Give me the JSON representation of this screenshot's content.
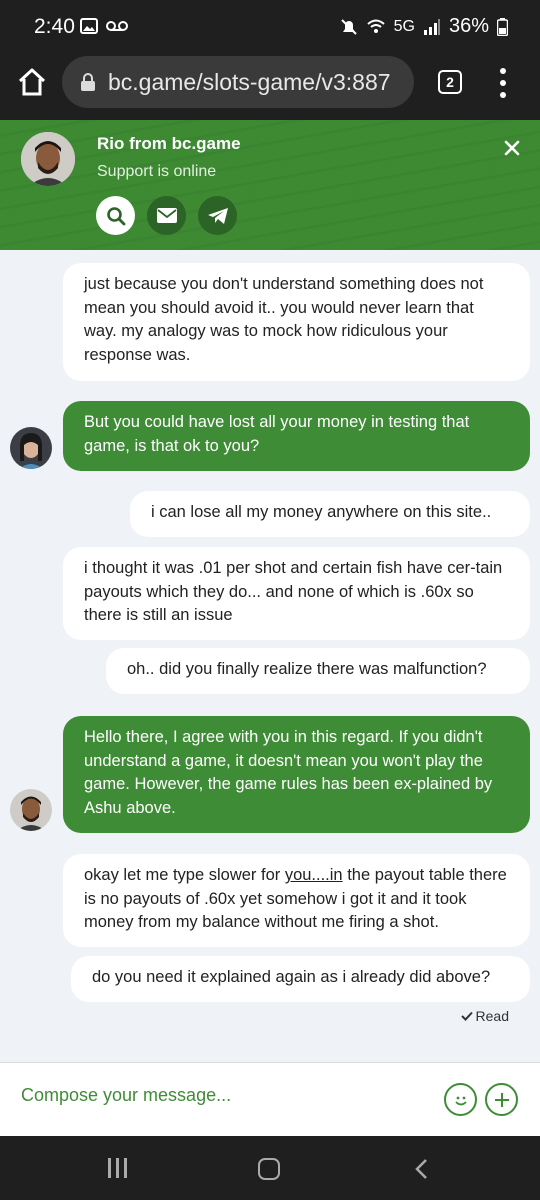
{
  "status_bar": {
    "time": "2:40",
    "network": "5G",
    "battery": "36%"
  },
  "browser": {
    "url": "bc.game/slots-game/v3:887",
    "tab_count": "2"
  },
  "chat_header": {
    "agent_name": "Rio from bc.game",
    "agent_status": "Support is online",
    "accent_color": "#3f8c36"
  },
  "messages": [
    {
      "sender": "me",
      "text": "just because you don't understand something does not mean you should avoid it.. you would never learn that way. my analogy was to mock how ridiculous your response was."
    },
    {
      "sender": "support",
      "text": "But you could have lost all your money in testing that game, is that ok to you?"
    },
    {
      "sender": "me",
      "text": "i can lose all my money anywhere on this site.."
    },
    {
      "sender": "me",
      "text": "i thought it was .01 per shot and certain fish have cer-tain payouts which they do... and none of which is .60x so there is still an issue"
    },
    {
      "sender": "me",
      "text": "oh.. did you finally realize there was malfunction?"
    },
    {
      "sender": "support",
      "text": "Hello there, I agree with you in this regard. If you didn't understand a game, it doesn't mean you won't play the game. However, the game rules has been ex-plained by Ashu above."
    },
    {
      "sender": "me",
      "text_before": "okay let me type slower for ",
      "link_text": "you....in",
      "text_after": " the payout table there is no payouts of .60x yet somehow i got it and it took money from my balance without me firing a shot."
    },
    {
      "sender": "me",
      "text": "do you need it explained again as i already did above?"
    }
  ],
  "read_receipt": "Read",
  "composer": {
    "placeholder": "Compose your message..."
  }
}
